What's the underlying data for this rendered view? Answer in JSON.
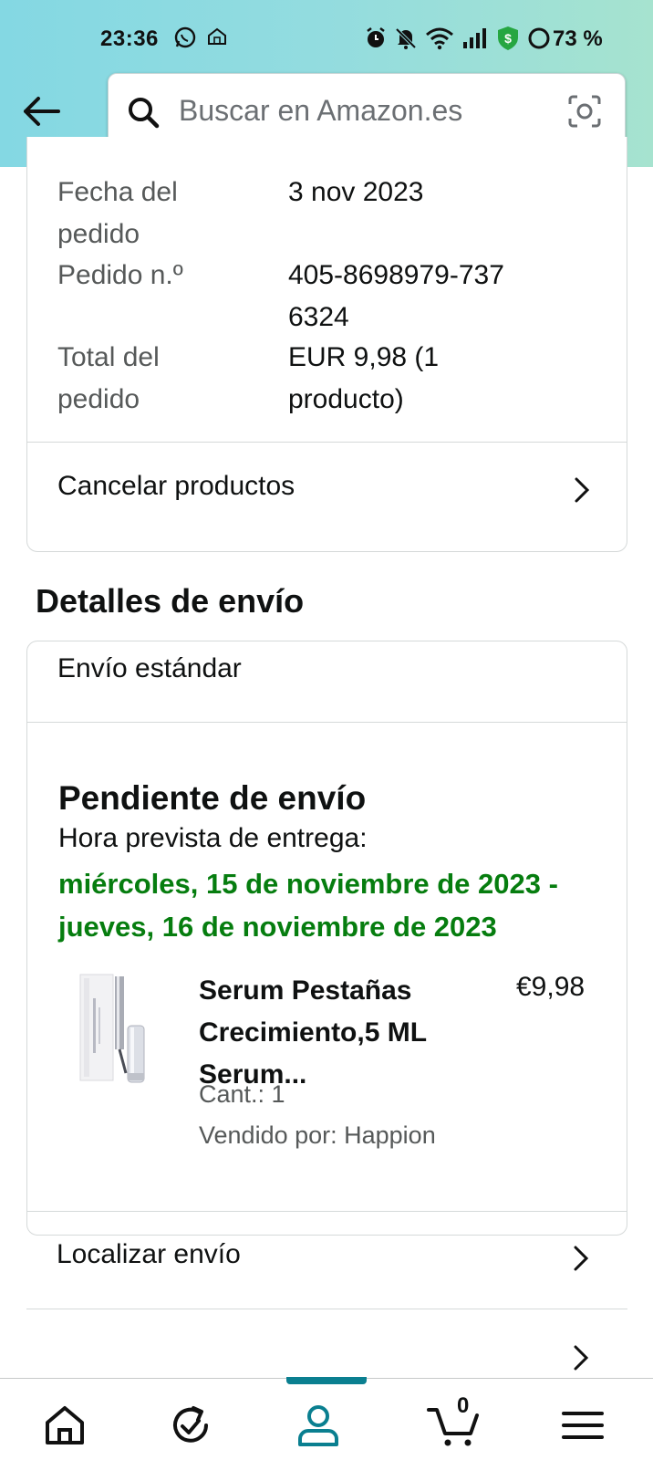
{
  "status_bar": {
    "time": "23:36",
    "battery": "73 %"
  },
  "search": {
    "placeholder": "Buscar en Amazon.es"
  },
  "order_summary": {
    "date_label": "Fecha del pedido",
    "date_value": "3 nov 2023",
    "number_label": "Pedido n.º",
    "number_value": "405-8698979-7376324",
    "total_label": "Total del pedido",
    "total_value": "EUR 9,98 (1 producto)",
    "cancel_link": "Cancelar productos"
  },
  "shipping": {
    "section_title": "Detalles de envío",
    "method": "Envío estándar",
    "status": "Pendiente de envío",
    "eta_label": "Hora prevista de entrega:",
    "eta_value": "miércoles, 15 de noviembre de 2023 - jueves, 16 de noviembre de 2023",
    "item": {
      "title": "Serum Pestañas Crecimiento,5 ML Serum...",
      "price": "€9,98",
      "quantity": "Cant.: 1",
      "seller": "Vendido por: Happion"
    },
    "track_link": "Localizar envío"
  },
  "bottom_nav": {
    "items": [
      "home-icon",
      "reorder-icon",
      "account-icon",
      "cart-icon",
      "menu-icon"
    ],
    "active": "account-icon",
    "cart_count": "0",
    "active_color": "#0a7f90"
  },
  "colors": {
    "delivery_green": "#067d0f",
    "header_gradient_start": "#84d8e3",
    "header_gradient_end": "#a6e3cf"
  }
}
